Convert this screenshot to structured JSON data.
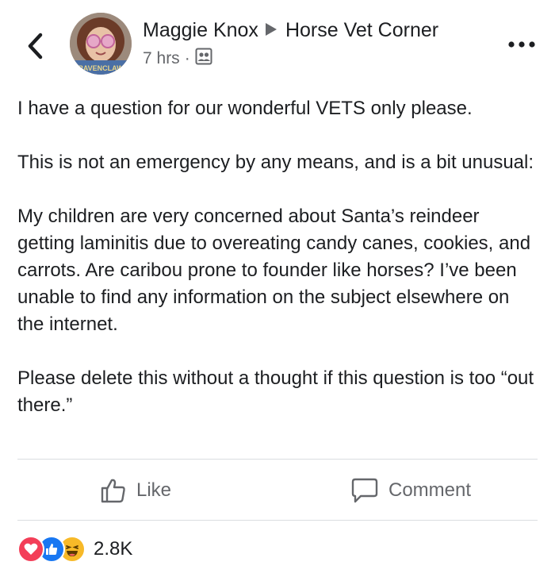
{
  "post": {
    "author": "Maggie Knox",
    "group": "Horse Vet Corner",
    "time": "7 hrs",
    "separator": "·",
    "privacy_icon": "group-members-icon",
    "avatar_badge": "RAVENCLAW",
    "paragraphs": [
      "I have a question for our wonderful VETS only please.",
      " This is not an emergency by any means, and is a bit unusual:",
      " My children are very concerned about Santa’s reindeer getting laminitis due to overeating candy canes, cookies, and carrots. Are caribou prone to founder like horses? I’ve been unable to find any information on the subject elsewhere on the internet.",
      "Please delete this without a thought if this question is too “out there.”"
    ]
  },
  "actions": {
    "like_label": "Like",
    "comment_label": "Comment"
  },
  "reactions": {
    "types": [
      "love",
      "like",
      "haha"
    ],
    "count": "2.8K"
  },
  "colors": {
    "love": "#f33e58",
    "like": "#1877f2",
    "haha": "#f7b928",
    "secondary_text": "#65676b",
    "divider": "#dadde1"
  }
}
